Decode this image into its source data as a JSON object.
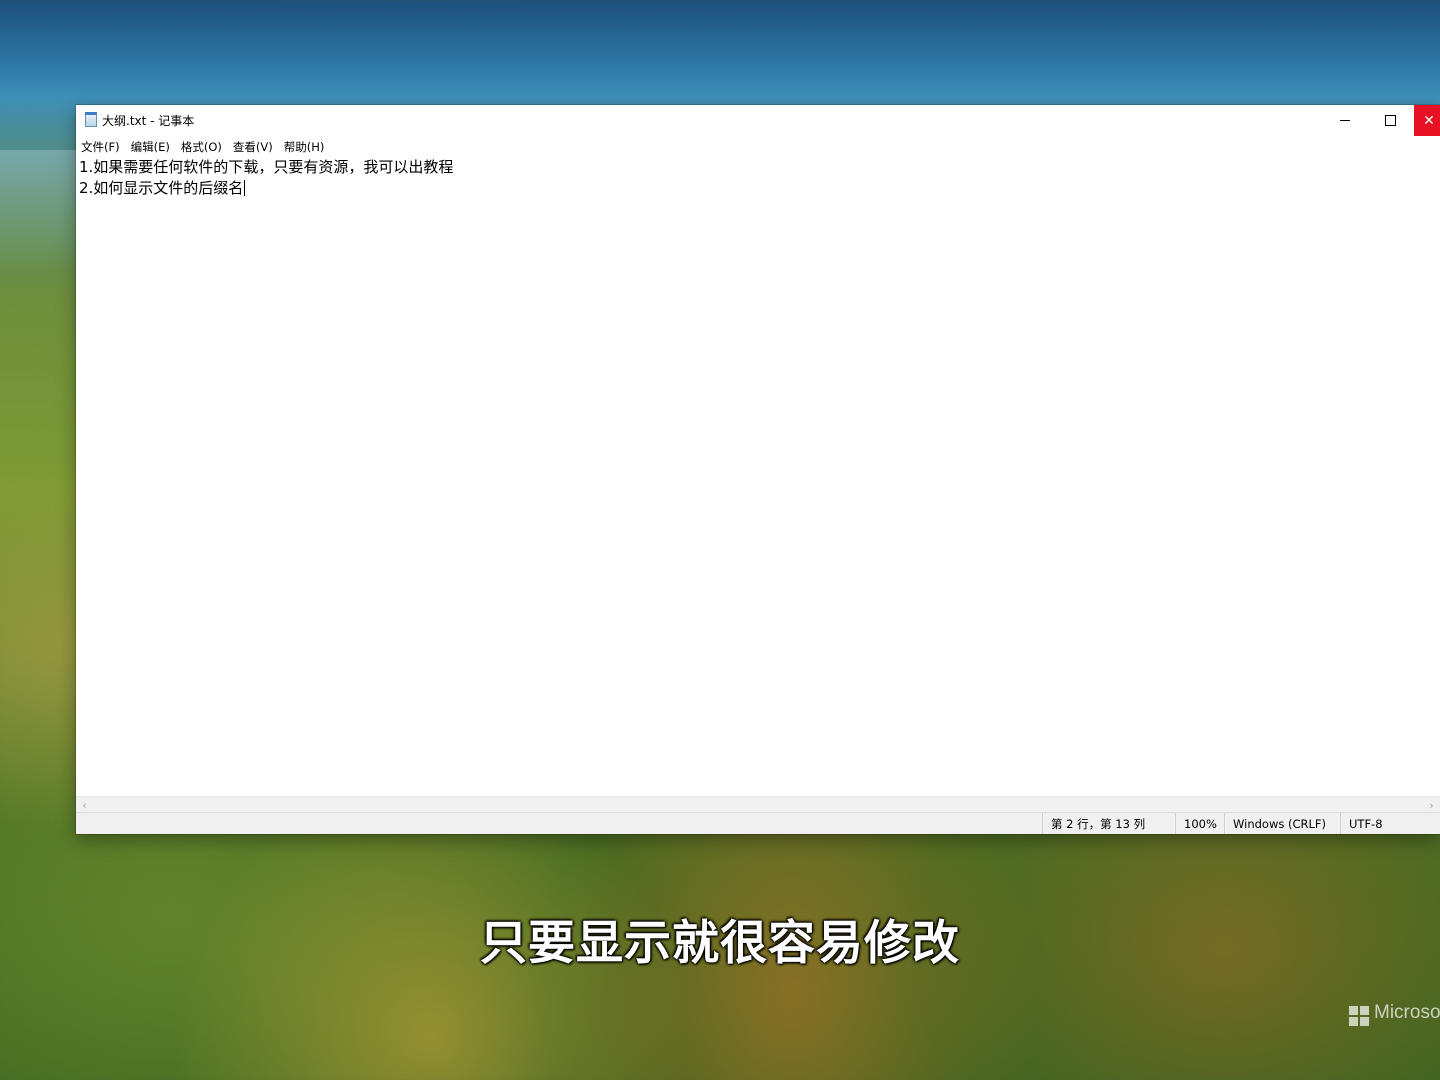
{
  "window": {
    "title": "大纲.txt - 记事本",
    "minimize_glyph": "",
    "close_glyph": "✕"
  },
  "menu": [
    {
      "label": "文件(F)"
    },
    {
      "label": "编辑(E)"
    },
    {
      "label": "格式(O)"
    },
    {
      "label": "查看(V)"
    },
    {
      "label": "帮助(H)"
    }
  ],
  "document": {
    "lines": [
      "1.如果需要任何软件的下载，只要有资源，我可以出教程",
      "2.如何显示文件的后缀名"
    ]
  },
  "statusbar": {
    "position": "第 2 行，第 13 列",
    "zoom": "100%",
    "line_ending": "Windows (CRLF)",
    "encoding": "UTF-8"
  },
  "scrollbar": {
    "left_arrow": "‹",
    "right_arrow": "›"
  },
  "subtitle": "只要显示就很容易修改",
  "watermark": {
    "text": "Microsoft"
  },
  "colors": {
    "close_button": "#e81123"
  }
}
